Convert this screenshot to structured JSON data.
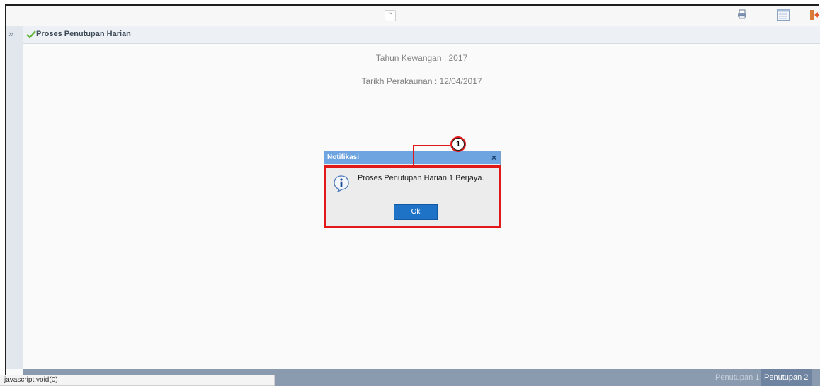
{
  "header": {
    "collapse_icon": "double-chevron-up-icon",
    "icons": [
      "printer-icon",
      "list-view-icon",
      "exit-icon"
    ]
  },
  "sidebar": {
    "toggle_icon": "double-chevron-right-icon",
    "toggle_label": "»"
  },
  "page": {
    "title": "Proses Penutupan Harian",
    "title_icon": "checkmark-icon",
    "info_line_1": "Tahun Kewangan : 2017",
    "info_line_2": "Tarikh Perakaunan : 12/04/2017"
  },
  "dialog": {
    "title": "Notifikasi",
    "close_label": "×",
    "icon": "info-icon",
    "message": "Proses Penutupan Harian 1 Berjaya.",
    "ok_label": "Ok"
  },
  "callout": {
    "number": "1",
    "color": "#e01818"
  },
  "bottom_tabs": [
    {
      "label": "Penutupan 1",
      "active": false
    },
    {
      "label": "Penutupan 2",
      "active": true
    }
  ],
  "status_bar": {
    "text": "javascript:void(0)"
  }
}
